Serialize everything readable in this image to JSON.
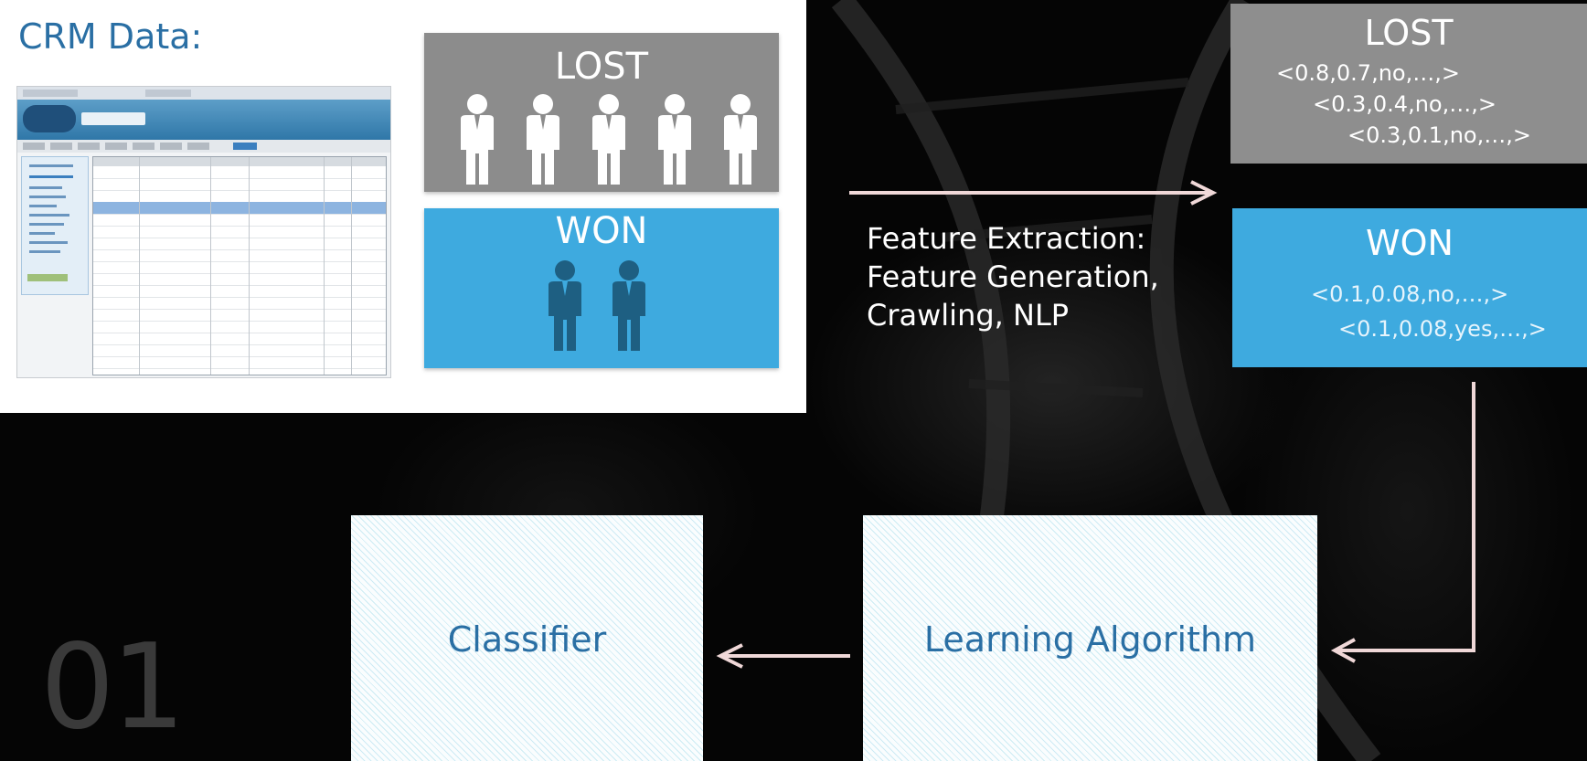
{
  "crm": {
    "title": "CRM Data:",
    "lost_label": "LOST",
    "won_label": "WON",
    "lost_count": 5,
    "won_count": 2
  },
  "feature_extraction": {
    "lines": [
      "Feature Extraction:",
      "Feature Generation,",
      "Crawling, NLP"
    ]
  },
  "lost_features": {
    "label": "LOST",
    "vectors": [
      "<0.8,0.7,no,…,>",
      "<0.3,0.4,no,…,>",
      "<0.3,0.1,no,…,>"
    ]
  },
  "won_features": {
    "label": "WON",
    "vectors": [
      "<0.1,0.08,no,…,>",
      "<0.1,0.08,yes,…,>"
    ]
  },
  "learning_algorithm": {
    "label": "Learning Algorithm"
  },
  "classifier": {
    "label": "Classifier"
  },
  "slide_number": "01",
  "colors": {
    "crm_title": "#2a6fa4",
    "lost_gray": "#8c8c8c",
    "won_blue": "#3eaadf",
    "won_person": "#1e5f82",
    "arrow": "#f0d8d8"
  }
}
